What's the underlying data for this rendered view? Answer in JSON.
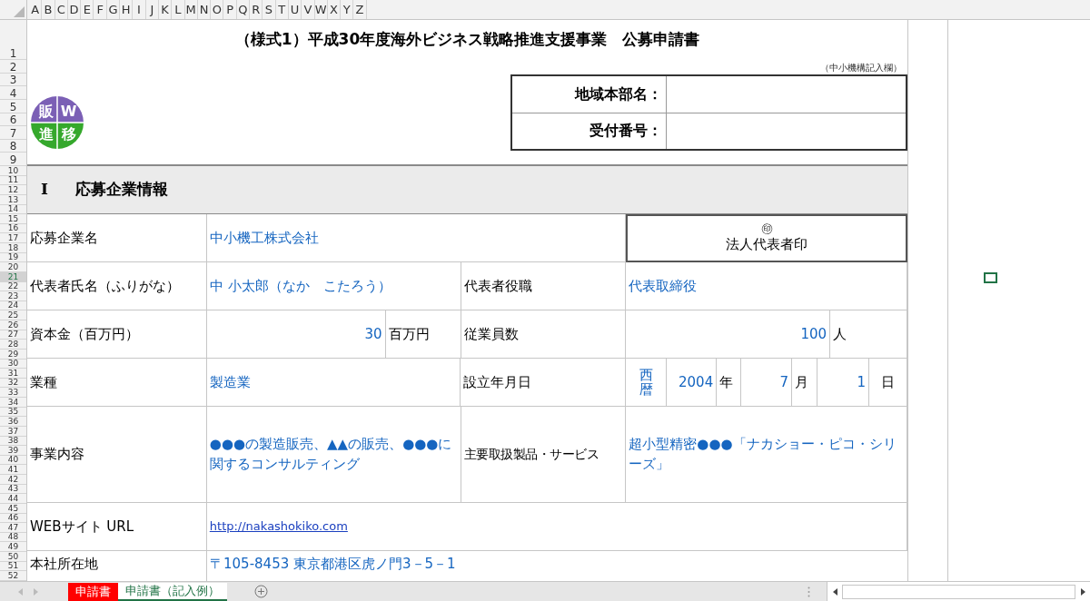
{
  "column_headers": [
    "A",
    "B",
    "C",
    "D",
    "E",
    "F",
    "G",
    "H",
    "I",
    "J",
    "K",
    "L",
    "M",
    "N",
    "O",
    "P",
    "Q",
    "R",
    "S",
    "T",
    "U",
    "V",
    "W",
    "X",
    "Y",
    "Z"
  ],
  "row_headers": [
    {
      "label": "1",
      "selected": false
    },
    {
      "label": "2",
      "selected": false
    },
    {
      "label": "3",
      "selected": false
    },
    {
      "label": "4",
      "selected": false
    },
    {
      "label": "5",
      "selected": false
    },
    {
      "label": "6",
      "selected": false
    },
    {
      "label": "7",
      "selected": false
    },
    {
      "label": "8",
      "selected": false
    },
    {
      "label": "9",
      "selected": false
    },
    {
      "label": "10",
      "selected": false
    },
    {
      "label": "11",
      "selected": false
    },
    {
      "label": "12",
      "selected": false
    },
    {
      "label": "13",
      "selected": false
    },
    {
      "label": "14",
      "selected": false
    },
    {
      "label": "15",
      "selected": false
    },
    {
      "label": "16",
      "selected": false
    },
    {
      "label": "17",
      "selected": false
    },
    {
      "label": "18",
      "selected": false
    },
    {
      "label": "19",
      "selected": false
    },
    {
      "label": "20",
      "selected": false
    },
    {
      "label": "21",
      "selected": true
    },
    {
      "label": "22",
      "selected": false
    },
    {
      "label": "23",
      "selected": false
    },
    {
      "label": "24",
      "selected": false
    },
    {
      "label": "25",
      "selected": false
    },
    {
      "label": "26",
      "selected": false
    },
    {
      "label": "27",
      "selected": false
    },
    {
      "label": "28",
      "selected": false
    },
    {
      "label": "29",
      "selected": false
    },
    {
      "label": "30",
      "selected": false
    },
    {
      "label": "31",
      "selected": false
    },
    {
      "label": "32",
      "selected": false
    },
    {
      "label": "33",
      "selected": false
    },
    {
      "label": "34",
      "selected": false
    },
    {
      "label": "35",
      "selected": false
    },
    {
      "label": "36",
      "selected": false
    },
    {
      "label": "37",
      "selected": false
    },
    {
      "label": "38",
      "selected": false
    },
    {
      "label": "39",
      "selected": false
    },
    {
      "label": "40",
      "selected": false
    },
    {
      "label": "41",
      "selected": false
    },
    {
      "label": "42",
      "selected": false
    },
    {
      "label": "43",
      "selected": false
    },
    {
      "label": "44",
      "selected": false
    },
    {
      "label": "45",
      "selected": false
    },
    {
      "label": "46",
      "selected": false
    },
    {
      "label": "47",
      "selected": false
    },
    {
      "label": "48",
      "selected": false
    },
    {
      "label": "49",
      "selected": false
    },
    {
      "label": "50",
      "selected": false
    },
    {
      "label": "51",
      "selected": false
    },
    {
      "label": "52",
      "selected": false
    }
  ],
  "title": "（様式1）平成30年度海外ビジネス戦略推進支援事業　公募申請書",
  "note": "（中小機構記入欄）",
  "office_box": [
    {
      "label": "地域本部名："
    },
    {
      "label": "受付番号："
    }
  ],
  "logo": [
    "販",
    "W",
    "進",
    "移"
  ],
  "section": {
    "number": "Ⅰ",
    "title": "応募企業情報"
  },
  "company_name": {
    "label": "応募企業名",
    "value": "中小機工株式会社"
  },
  "seal": {
    "mark": "㊞",
    "label": "法人代表者印"
  },
  "representative": {
    "label": "代表者氏名（ふりがな）",
    "value": "中 小太郎（なか　こたろう）",
    "title_label": "代表者役職",
    "title_value": "代表取締役"
  },
  "capital": {
    "label": "資本金（百万円）",
    "value": "30",
    "unit": "百万円",
    "employees_label": "従業員数",
    "employees_value": "100",
    "employees_unit": "人"
  },
  "industry": {
    "label": "業種",
    "value": "製造業",
    "founded_label": "設立年月日",
    "era": "西暦",
    "year": "2004",
    "year_unit": "年",
    "month": "7",
    "month_unit": "月",
    "day": "1",
    "day_unit": "日"
  },
  "business": {
    "label": "事業内容",
    "value": "●●●の製造販売、▲▲の販売、●●●に関するコンサルティング",
    "products_label": "主要取扱製品・サービス",
    "products_value": "超小型精密●●●「ナカショー・ピコ・シリーズ」"
  },
  "website": {
    "label": "WEBサイト URL",
    "value": "http://nakashokiko.com"
  },
  "address": {
    "label": "本社所在地",
    "value": "〒105-8453 東京都港区虎ノ門3－5－1"
  },
  "sheet_tabs": [
    {
      "label": "申請書",
      "selected": false,
      "color": "#ff0000"
    },
    {
      "label": "申請書（記入例）",
      "selected": true,
      "color": "#ffffff"
    }
  ]
}
